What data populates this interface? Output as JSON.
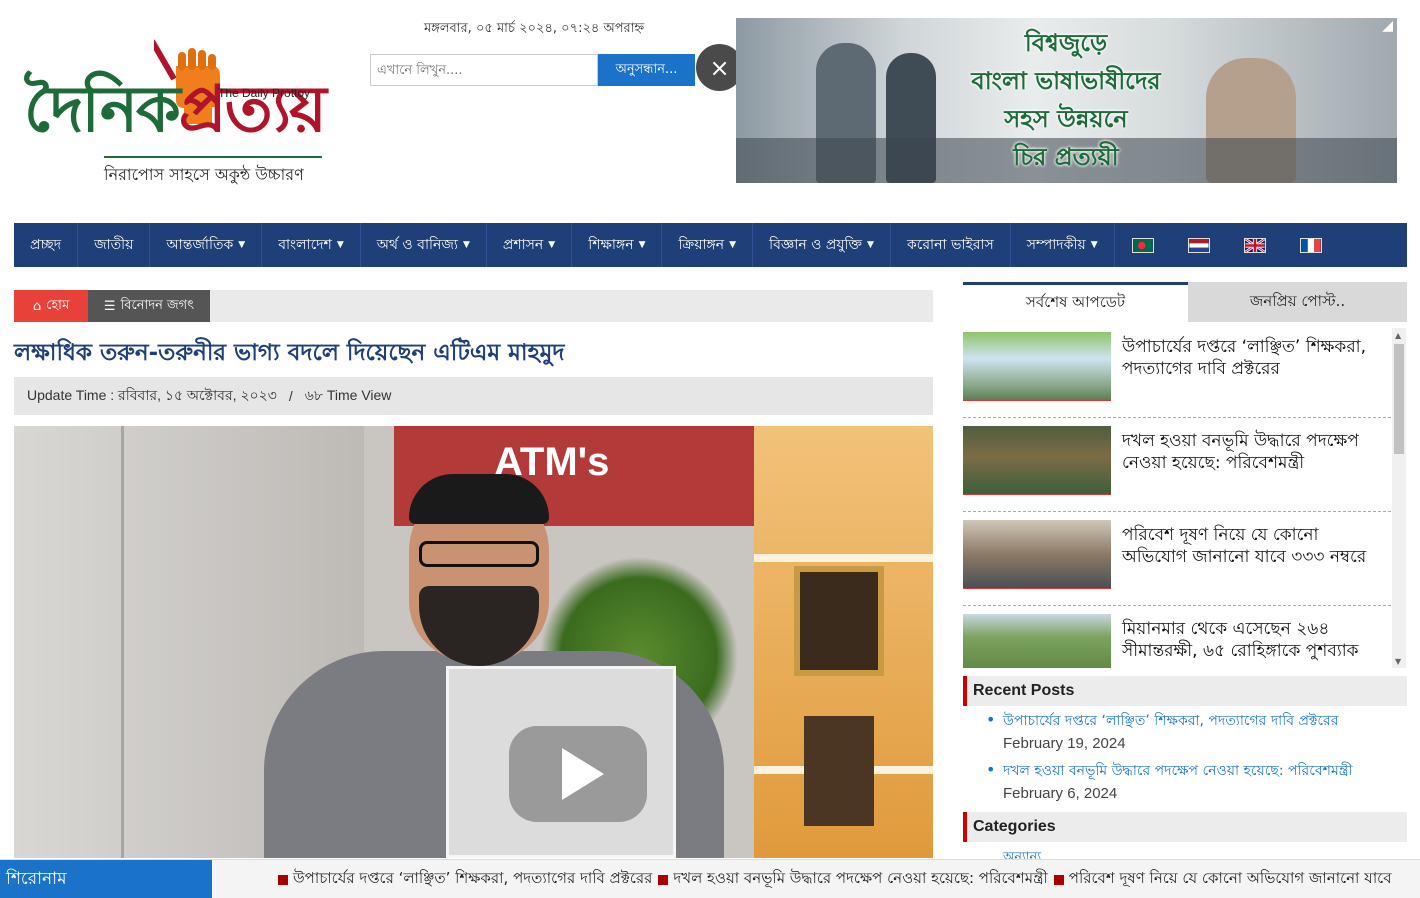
{
  "header": {
    "date": "মঙ্গলবার, ০৫ মার্চ ২০২৪, ০৭:২৪ অপরাহ্ন",
    "logo_main_green": "দৈনিক",
    "logo_main_red": "প্রত্যয়",
    "logo_english": "The Daily Prottoy",
    "logo_tagline": "নিরাপোস সাহসে অকুন্ঠ উচ্চারণ",
    "search_placeholder": "এখানে লিখুন....",
    "search_button": "অনুসন্ধান...",
    "close_label": "×"
  },
  "ad": {
    "text_lines": [
      "বিশ্বজুড়ে",
      "বাংলা ভাষাভাষীদের",
      "সহস উন্নয়নে",
      "চির প্রত্যয়ী"
    ]
  },
  "nav": {
    "items": [
      {
        "label": "প্রচ্ছদ",
        "dropdown": false
      },
      {
        "label": "জাতীয়",
        "dropdown": false
      },
      {
        "label": "আন্তর্জাতিক",
        "dropdown": true
      },
      {
        "label": "বাংলাদেশ",
        "dropdown": true
      },
      {
        "label": "অর্থ ও বানিজ্য",
        "dropdown": true
      },
      {
        "label": "প্রশাসন",
        "dropdown": true
      },
      {
        "label": "শিক্ষাঙ্গন",
        "dropdown": true
      },
      {
        "label": "ক্রিয়াঙ্গন",
        "dropdown": true
      },
      {
        "label": "বিজ্ঞান ও প্রযুক্তি",
        "dropdown": true
      },
      {
        "label": "করোনা ভাইরাস",
        "dropdown": false
      },
      {
        "label": "সম্পাদকীয়",
        "dropdown": true
      }
    ],
    "flags": [
      "bangladesh-flag",
      "netherlands-flag",
      "uk-flag",
      "france-flag"
    ]
  },
  "breadcrumb": {
    "home": "হোম",
    "category": "বিনোদন জগৎ"
  },
  "article": {
    "headline": "লক্ষাধিক তরুন-তরুনীর ভাগ্য বদলে দিয়েছেন এটিএম মাহমুদ",
    "update_label": "Update Time : রবিবার, ১৫ অক্টোবর, ২০২৩",
    "separator": "/",
    "views": "৬৮ Time View",
    "image_sign": "ATM's"
  },
  "sidebar": {
    "tab_latest": "সর্বশেষ আপডেট",
    "tab_popular": "জনপ্রিয় পোস্ট..",
    "feed": [
      {
        "title": "উপাচার্যের দপ্তরে ‘লাঞ্ছিত’ শিক্ষকরা, পদত্যাগের দাবি প্রক্টরের"
      },
      {
        "title": "দখল হওয়া বনভূমি উদ্ধারে পদক্ষেপ নেওয়া হয়েছে: পরিবেশমন্ত্রী"
      },
      {
        "title": "পরিবেশ দূষণ নিয়ে যে কোনো অভিযোগ জানানো যাবে ৩৩৩ নম্বরে"
      },
      {
        "title": "মিয়ানমার থেকে এসেছেন ২৬৪ সীমান্তরক্ষী, ৬৫ রোহিঙ্গাকে পুশব্যাক"
      }
    ],
    "recent_heading": "Recent Posts",
    "recent": [
      {
        "title": "উপাচার্যের দপ্তরে ‘লাঞ্ছিত’ শিক্ষকরা, পদত্যাগের দাবি প্রক্টরের",
        "date": "February 19, 2024"
      },
      {
        "title": "দখল হওয়া বনভূমি উদ্ধারে পদক্ষেপ নেওয়া হয়েছে: পরিবেশমন্ত্রী",
        "date": "February 6, 2024"
      }
    ],
    "categories_heading": "Categories",
    "category_first": "অন্যান্য"
  },
  "ticker": {
    "label": "শিরোনাম",
    "items": [
      "উপাচার্যের দপ্তরে ‘লাঞ্ছিত’ শিক্ষকরা, পদত্যাগের দাবি প্রক্টরের",
      "দখল হওয়া বনভূমি উদ্ধারে পদক্ষেপ নেওয়া হয়েছে: পরিবেশমন্ত্রী",
      "পরিবেশ দূষণ নিয়ে যে কোনো অভিযোগ জানানো যাবে"
    ]
  },
  "colors": {
    "nav_bg": "#1e3f78",
    "home_red": "#e8413a",
    "search_blue": "#1a73c8",
    "logo_green": "#1e6b3a",
    "logo_red": "#b0142a"
  }
}
